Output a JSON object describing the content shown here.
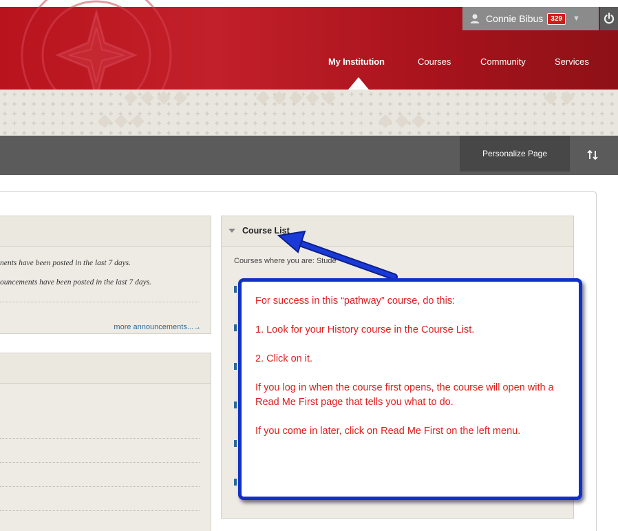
{
  "header": {
    "user_name": "Connie Bibus",
    "notification_count": "329",
    "nav": {
      "my_institution": "My Institution",
      "courses": "Courses",
      "community": "Community",
      "services": "Services"
    }
  },
  "toolbar": {
    "personalize_label": "Personalize Page"
  },
  "announcements": {
    "line1": "nents have been posted in the last 7 days.",
    "line2": "ouncements have been posted in the last 7 days.",
    "more_link": "more announcements...→"
  },
  "course_list": {
    "title": "Course List",
    "subtitle": "Courses where you are: Stude"
  },
  "callout": {
    "line1": "For success in this “pathway” course, do this:",
    "line2": "1. Look for your History course in the Course List.",
    "line3": "2. Click on it.",
    "line4": "If you log in when the course first opens, the course will open with a Read Me First page that tells you what to do.",
    "line5": "If you come in later, click on Read Me First on the left menu."
  },
  "colors": {
    "header_red": "#b9141e",
    "callout_border": "#1030c8",
    "callout_text": "#e01e1e",
    "badge_red": "#d41b1b"
  }
}
